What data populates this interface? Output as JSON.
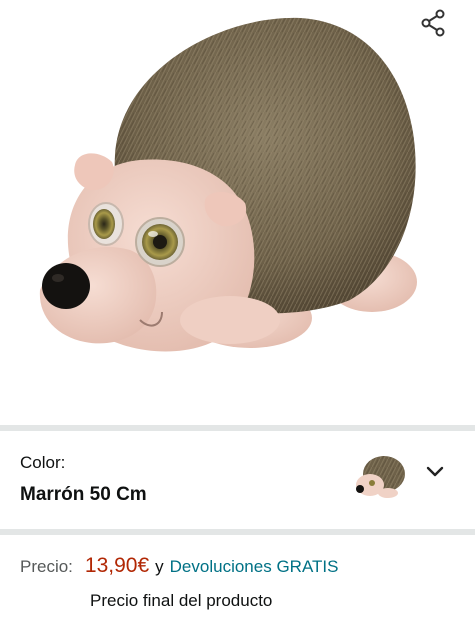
{
  "product": {
    "image": "hedgehog plush toy"
  },
  "share": {
    "icon": "share-icon"
  },
  "variant": {
    "label": "Color:",
    "value": "Marrón 50 Cm",
    "thumbnail": "hedgehog-thumbnail",
    "dropdown_icon": "chevron-down-icon"
  },
  "pricing": {
    "label": "Precio:",
    "price": "13,90€",
    "connector": "y",
    "returns_link": "Devoluciones GRATIS",
    "final_note": "Precio final del producto"
  },
  "colors": {
    "price": "#b12704",
    "link": "#007185",
    "divider": "#e3e6e6"
  }
}
